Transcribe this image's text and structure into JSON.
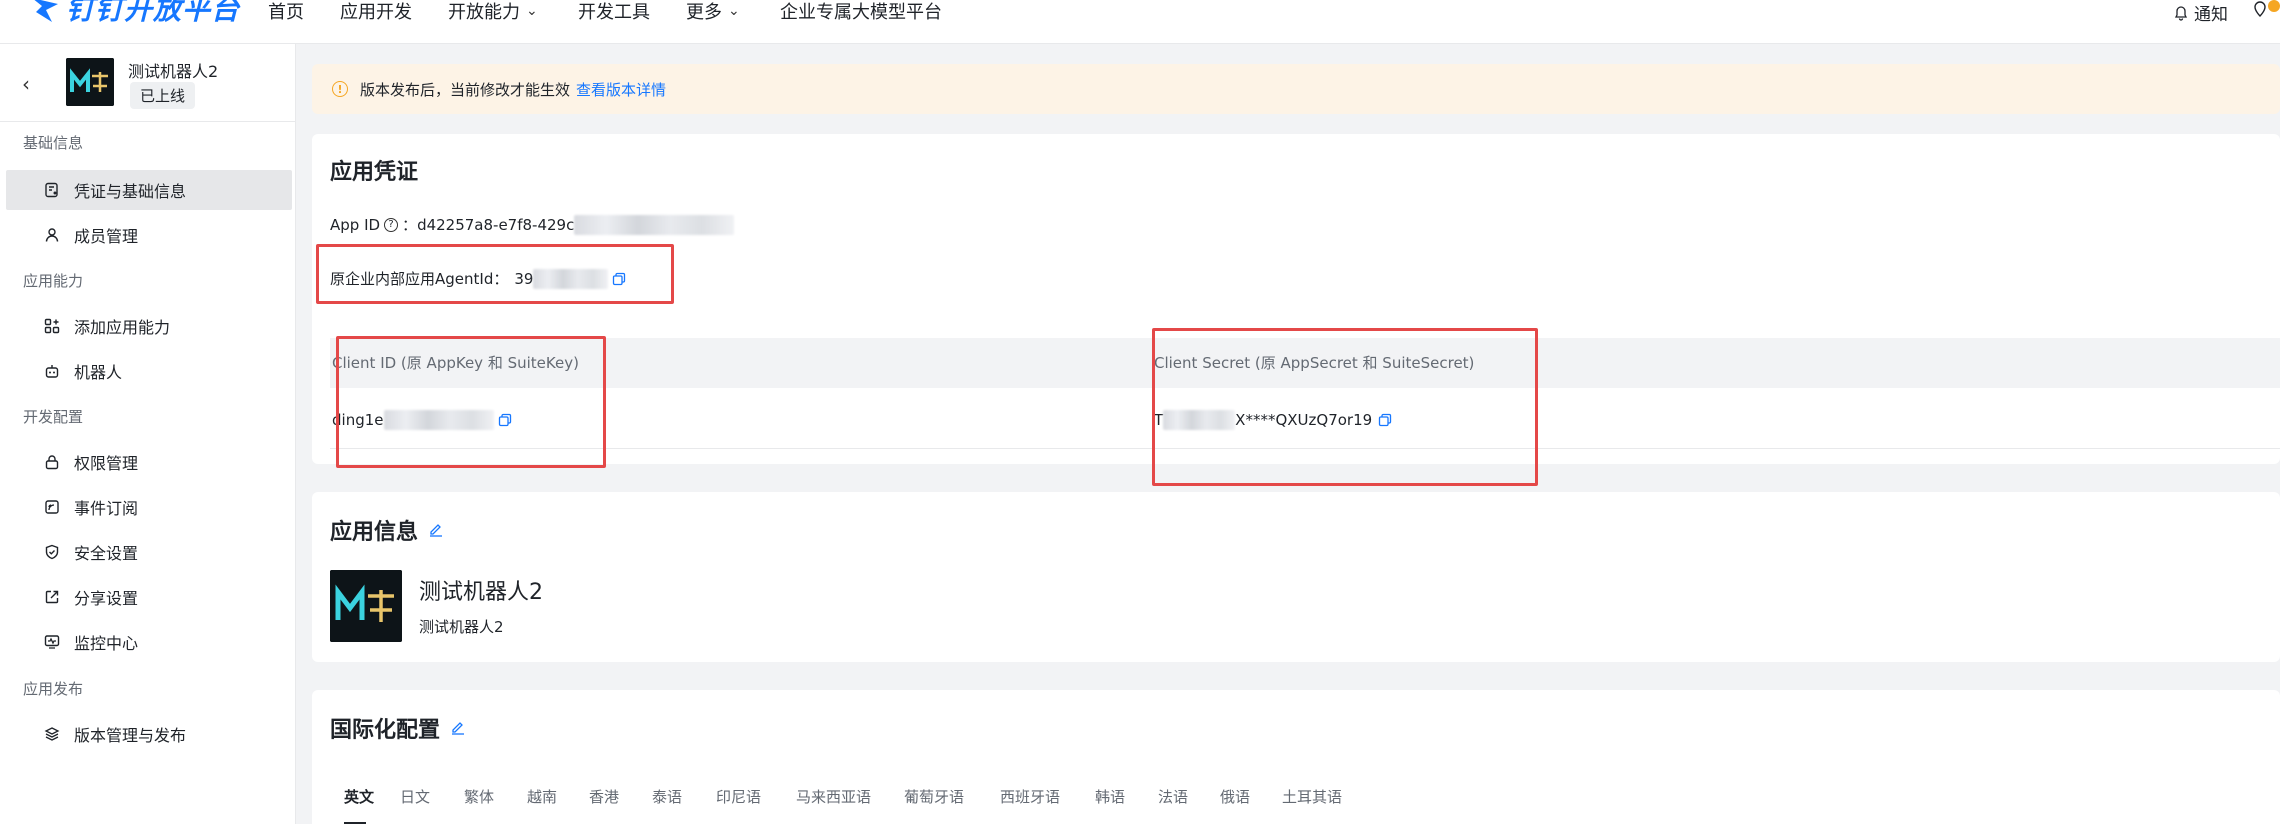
{
  "nav": {
    "brand": "钉钉开放平台",
    "items": [
      {
        "label": "首页",
        "dropdown": false
      },
      {
        "label": "应用开发",
        "dropdown": false
      },
      {
        "label": "开放能力",
        "dropdown": true
      },
      {
        "label": "开发工具",
        "dropdown": false
      },
      {
        "label": "更多",
        "dropdown": true
      },
      {
        "label": "企业专属大模型平台",
        "dropdown": false
      }
    ],
    "notify_label": "通知"
  },
  "app": {
    "name": "测试机器人2",
    "status": "已上线"
  },
  "sidebar": {
    "sections": [
      {
        "title": "基础信息",
        "items": [
          {
            "label": "凭证与基础信息",
            "icon": "doc-info-icon",
            "active": true
          },
          {
            "label": "成员管理",
            "icon": "user-icon",
            "active": false
          }
        ]
      },
      {
        "title": "应用能力",
        "items": [
          {
            "label": "添加应用能力",
            "icon": "add-grid-icon",
            "active": false
          },
          {
            "label": "机器人",
            "icon": "robot-icon",
            "active": false
          }
        ]
      },
      {
        "title": "开发配置",
        "items": [
          {
            "label": "权限管理",
            "icon": "lock-icon",
            "active": false
          },
          {
            "label": "事件订阅",
            "icon": "event-icon",
            "active": false
          },
          {
            "label": "安全设置",
            "icon": "shield-icon",
            "active": false
          },
          {
            "label": "分享设置",
            "icon": "share-icon",
            "active": false
          },
          {
            "label": "监控中心",
            "icon": "monitor-icon",
            "active": false
          }
        ]
      },
      {
        "title": "应用发布",
        "items": [
          {
            "label": "版本管理与发布",
            "icon": "layers-icon",
            "active": false
          }
        ]
      }
    ]
  },
  "banner": {
    "text": "版本发布后，当前修改才能生效",
    "link": "查看版本详情"
  },
  "credentials": {
    "title": "应用凭证",
    "app_id_label": "App ID",
    "app_id_value": "d42257a8-e7f8-429c",
    "agent_label": "原企业内部应用AgentId：",
    "agent_value": "39",
    "client_id_header": "Client ID (原 AppKey 和 SuiteKey)",
    "client_id_value": "ding1e",
    "client_secret_header": "Client Secret (原 AppSecret 和 SuiteSecret)",
    "client_secret_prefix": "T",
    "client_secret_value": "X****QXUzQ7or19"
  },
  "app_info": {
    "title": "应用信息",
    "name": "测试机器人2",
    "desc": "测试机器人2"
  },
  "i18n": {
    "title": "国际化配置",
    "tabs": [
      "英文",
      "日文",
      "繁体",
      "越南",
      "香港",
      "泰语",
      "印尼语",
      "马来西亚语",
      "葡萄牙语",
      "西班牙语",
      "韩语",
      "法语",
      "俄语",
      "土耳其语"
    ],
    "active": 0
  },
  "colors": {
    "accent": "#1677ff",
    "highlight_box": "#e44848",
    "banner_bg": "#fdf3e6"
  }
}
